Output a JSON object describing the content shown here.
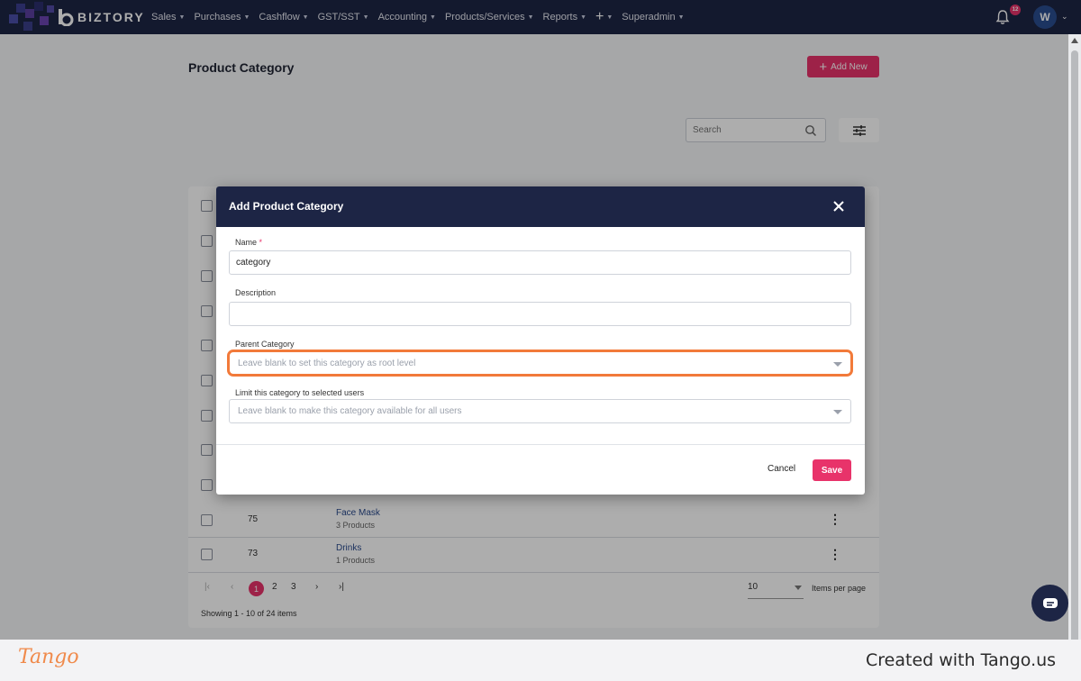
{
  "nav": {
    "brand": "BIZTORY",
    "menu": [
      {
        "label": "Sales"
      },
      {
        "label": "Purchases"
      },
      {
        "label": "Cashflow"
      },
      {
        "label": "GST/SST"
      },
      {
        "label": "Accounting"
      },
      {
        "label": "Products/Services"
      },
      {
        "label": "Reports"
      },
      {
        "label": "+"
      },
      {
        "label": "Superadmin"
      }
    ],
    "notifications_count": "12",
    "avatar_initial": "W"
  },
  "page": {
    "title": "Product Category",
    "add_new_label": "Add New",
    "search_placeholder": "Search"
  },
  "table": {
    "rows": [
      {
        "id": "75",
        "name": "Face Mask",
        "products": "3 Products"
      },
      {
        "id": "73",
        "name": "Drinks",
        "products": "1 Products"
      }
    ],
    "pagination": {
      "pages": [
        "1",
        "2",
        "3"
      ],
      "current": "1",
      "per_page": "10",
      "per_page_label": "Items per page",
      "showing": "Showing 1 - 10 of 24 items"
    }
  },
  "modal": {
    "title": "Add Product Category",
    "name_label": "Name",
    "name_required_mark": "*",
    "name_value": "category",
    "description_label": "Description",
    "description_value": "",
    "parent_label": "Parent Category",
    "parent_placeholder": "Leave blank to set this category as root level",
    "limit_label": "Limit this category to selected users",
    "limit_placeholder": "Leave blank to make this category available for all users",
    "cancel_label": "Cancel",
    "save_label": "Save"
  },
  "footer": {
    "logo": "Tango",
    "credit": "Created with Tango.us"
  },
  "colors": {
    "nav_bg": "#1d2545",
    "accent": "#e8336a",
    "highlight": "#f27a3a"
  }
}
